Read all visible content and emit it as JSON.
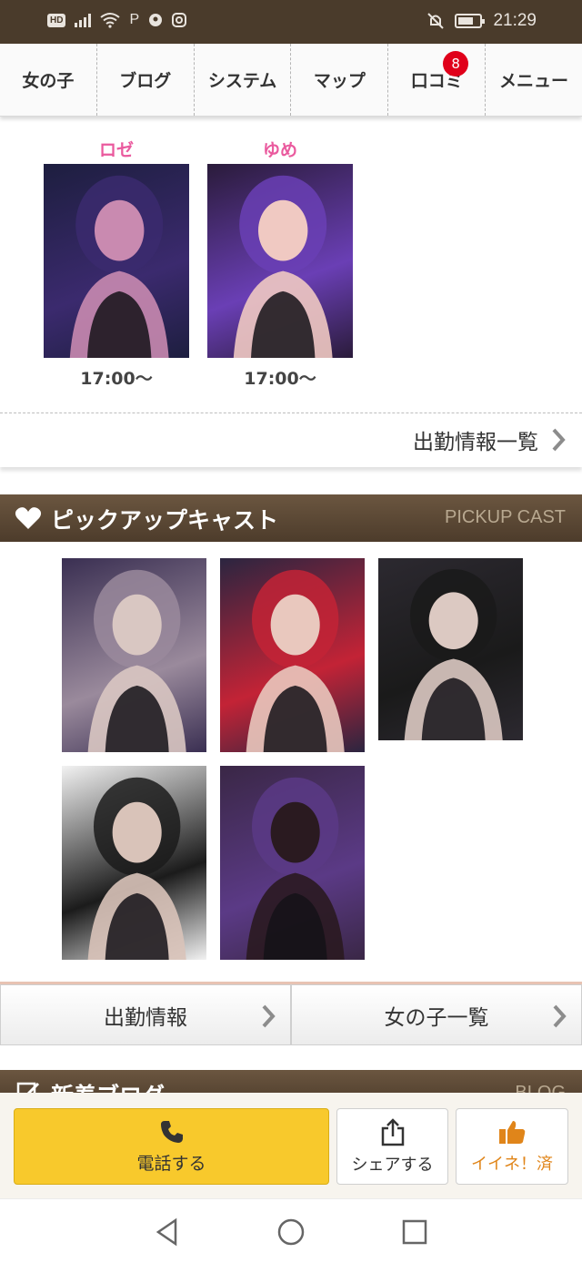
{
  "status_bar": {
    "hd": "HD",
    "time": "21:29",
    "icons": [
      "signal-icon",
      "wifi-icon",
      "parking-icon",
      "chat-icon",
      "instagram-icon",
      "mute-icon",
      "battery-icon"
    ]
  },
  "nav": {
    "items": [
      {
        "label": "女の子"
      },
      {
        "label": "ブログ"
      },
      {
        "label": "システム"
      },
      {
        "label": "マップ"
      },
      {
        "label": "口コミ",
        "badge": "8"
      },
      {
        "label": "メニュー"
      }
    ]
  },
  "schedule": {
    "casts": [
      {
        "name": "ロゼ",
        "time": "17:00〜",
        "photo_colors": [
          "#1d1e3f",
          "#3b2a6e",
          "#c98ab0"
        ]
      },
      {
        "name": "ゆめ",
        "time": "17:00〜",
        "photo_colors": [
          "#2a1b3a",
          "#6a3fb5",
          "#f0c9c2"
        ]
      }
    ],
    "more_label": "出勤情報一覧"
  },
  "pickup": {
    "title": "ピックアップキャスト",
    "en_label": "PICKUP CAST",
    "photos": [
      {
        "colors": [
          "#3a2f52",
          "#9a8a9c",
          "#d9c7c2"
        ]
      },
      {
        "colors": [
          "#2b2540",
          "#c32336",
          "#e9c8be"
        ]
      },
      {
        "colors": [
          "#2c2930",
          "#1a1a1a",
          "#dcc9c2"
        ]
      },
      {
        "colors": [
          "#f2f2f2",
          "#1b1b1b",
          "#d9c3b9"
        ]
      },
      {
        "colors": [
          "#3a2746",
          "#5b3a86",
          "#2a1a20"
        ]
      }
    ]
  },
  "tabs": {
    "schedule": "出勤情報",
    "girls": "女の子一覧"
  },
  "blog_head": {
    "title": "新着ブログ",
    "en_label": "BLOG"
  },
  "actions": {
    "call": "電話する",
    "share": "シェアする",
    "like": "イイネ！済"
  },
  "colors": {
    "brand_brown": "#4d3c2b",
    "pink_name": "#ea5a9e",
    "call_yellow": "#f8c92c",
    "like_orange": "#e0851a",
    "badge_red": "#e0001a"
  }
}
